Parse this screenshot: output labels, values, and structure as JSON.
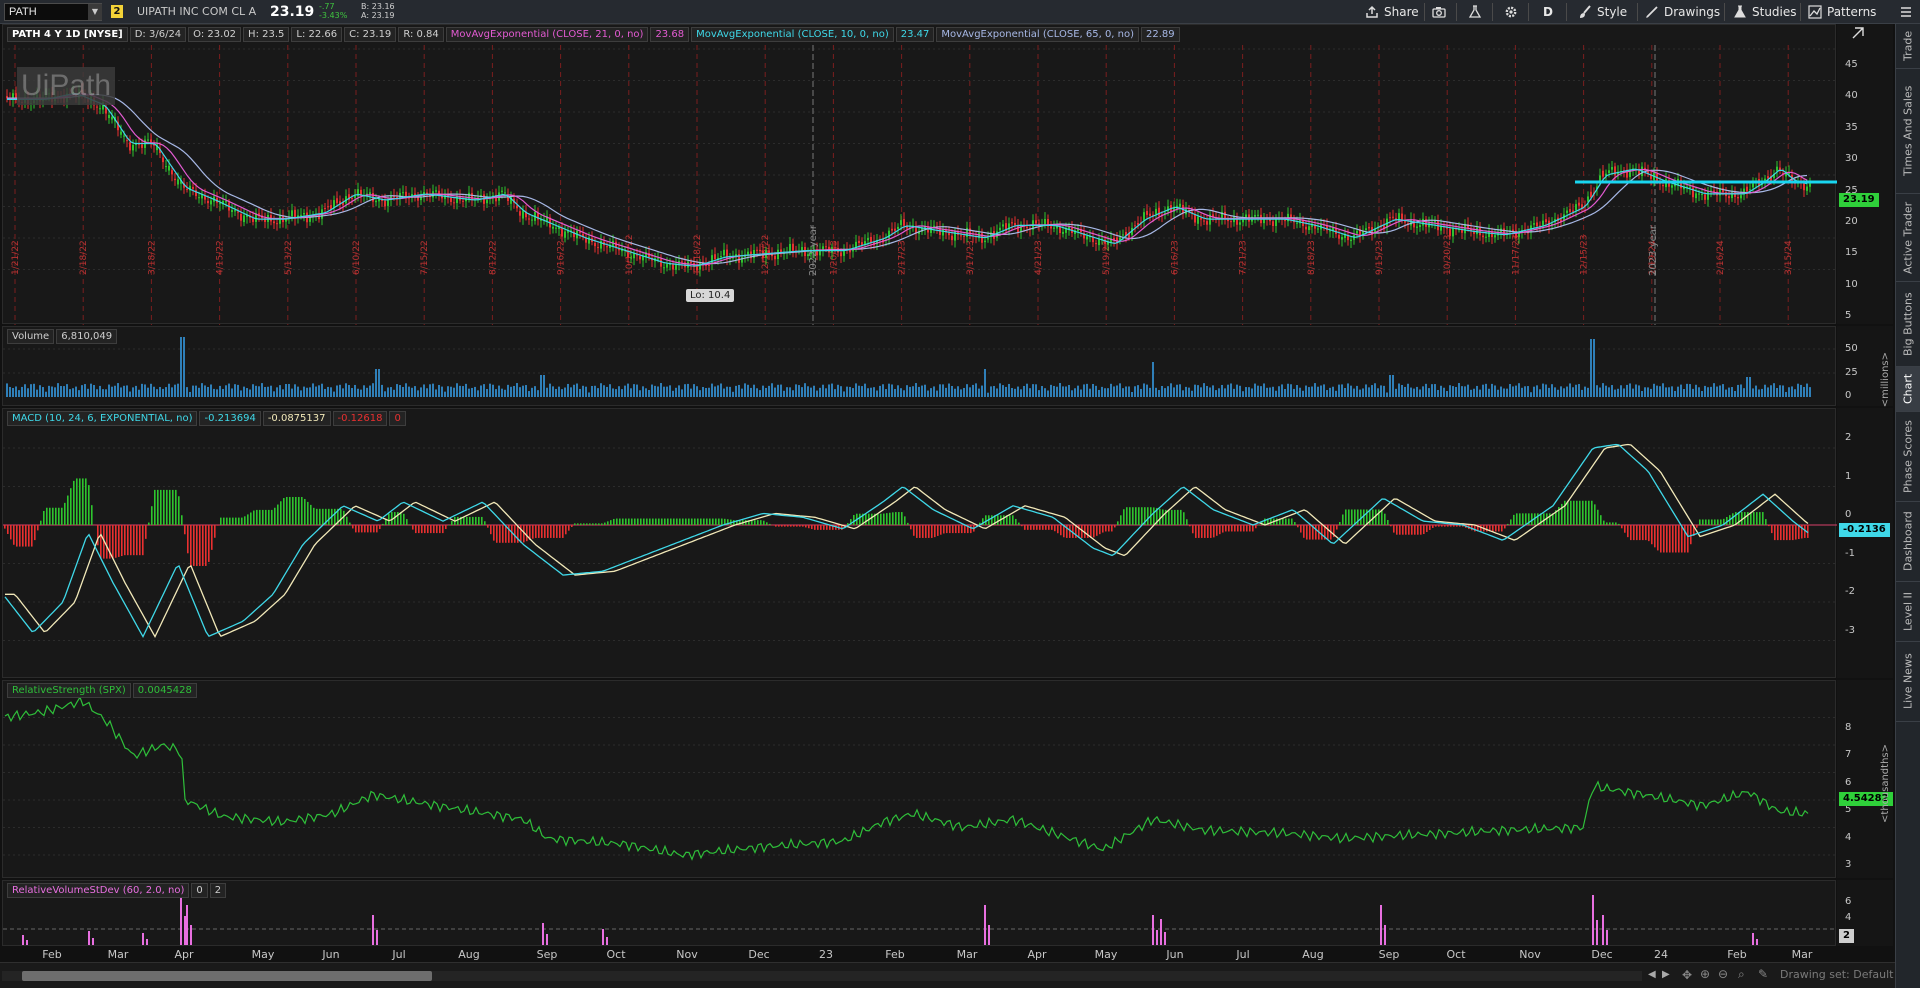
{
  "toolbar": {
    "symbol": "PATH",
    "link_number": "2",
    "company": "UIPATH INC COM CL A",
    "last": "23.19",
    "change_abs": "-.77",
    "change_pct": "-3.43%",
    "bid": "B: 23.16",
    "ask": "A: 23.19",
    "buttons": {
      "share": "Share",
      "period": "D",
      "style": "Style",
      "drawings": "Drawings",
      "studies": "Studies",
      "patterns": "Patterns"
    }
  },
  "right_tabs": [
    "Trade",
    "Times And Sales",
    "Active Trader",
    "Big Buttons",
    "Chart",
    "Phase Scores",
    "Dashboard",
    "Level II",
    "Live News"
  ],
  "price_pane": {
    "title": "PATH 4 Y 1D [NYSE]",
    "ohlc": [
      "D: 3/6/24",
      "O: 23.02",
      "H: 23.5",
      "L: 22.66",
      "C: 23.19",
      "R: 0.84"
    ],
    "studies": [
      {
        "label": "MovAvgExponential (CLOSE, 21, 0, no)",
        "value": "23.68",
        "color": "#e35bd2"
      },
      {
        "label": "MovAvgExponential (CLOSE, 10, 0, no)",
        "value": "23.47",
        "color": "#3fd8e8"
      },
      {
        "label": "MovAvgExponential (CLOSE, 65, 0, no)",
        "value": "22.89",
        "color": "#a7b8e6"
      }
    ],
    "low_bubble": "Lo: 10.4",
    "year_markers": [
      "2022 year",
      "2023 year"
    ],
    "logo": "UiPath",
    "axis_ticks": [
      "45",
      "40",
      "35",
      "30",
      "25",
      "20",
      "15",
      "10",
      "5"
    ],
    "price_tag": "23.19",
    "resistance_color": "#19d6f0",
    "date_marks": [
      "1/21/22",
      "2/18/22",
      "3/18/22",
      "4/15/22",
      "5/13/22",
      "6/10/22",
      "7/15/22",
      "8/12/22",
      "9/16/22",
      "10/14/22",
      "11/18/22",
      "12/16/22",
      "1/20/23",
      "2/17/23",
      "3/17/23",
      "4/21/23",
      "5/19/23",
      "6/16/23",
      "7/21/23",
      "8/18/23",
      "9/15/23",
      "10/20/23",
      "11/17/23",
      "12/15/23",
      "1/19/24",
      "2/16/24",
      "3/15/24"
    ]
  },
  "volume_pane": {
    "label": "Volume",
    "value": "6,810,049",
    "axis_ticks": [
      "50",
      "25",
      "0"
    ],
    "units": "<millions>"
  },
  "macd_pane": {
    "label": "MACD (10, 24, 6, EXPONENTIAL, no)",
    "values": [
      "-0.213694",
      "-0.0875137",
      "-0.12618",
      "0"
    ],
    "axis_ticks": [
      "2",
      "1",
      "0",
      "-1",
      "-2",
      "-3"
    ],
    "price_tag": "-0.2136"
  },
  "rs_pane": {
    "label": "RelativeStrength (SPX)",
    "value": "0.0045428",
    "axis_ticks": [
      "8",
      "7",
      "6",
      "5",
      "4",
      "3"
    ],
    "price_tag": "4.54282",
    "units": "<thousandths>"
  },
  "rvs_pane": {
    "label": "RelativeVolumeStDev (60, 2.0, no)",
    "values": [
      "0",
      "2"
    ],
    "axis_ticks": [
      "6",
      "4",
      "2"
    ],
    "price_tag": "2"
  },
  "time_axis": [
    "Feb",
    "Mar",
    "Apr",
    "May",
    "Jun",
    "Jul",
    "Aug",
    "Sep",
    "Oct",
    "Nov",
    "Dec",
    "23",
    "Feb",
    "Mar",
    "Apr",
    "May",
    "Jun",
    "Jul",
    "Aug",
    "Sep",
    "Oct",
    "Nov",
    "Dec",
    "24",
    "Feb",
    "Mar"
  ],
  "bottom": {
    "drawing_set": "Drawing set: Default"
  },
  "colors": {
    "up": "#2ec42e",
    "down": "#e83030",
    "volume": "#2f7fb8",
    "macd_line": "#3fd8e8",
    "signal_line": "#f1e8b8",
    "rs_line": "#2fbf3a",
    "rvs": "#e86fe0"
  }
}
